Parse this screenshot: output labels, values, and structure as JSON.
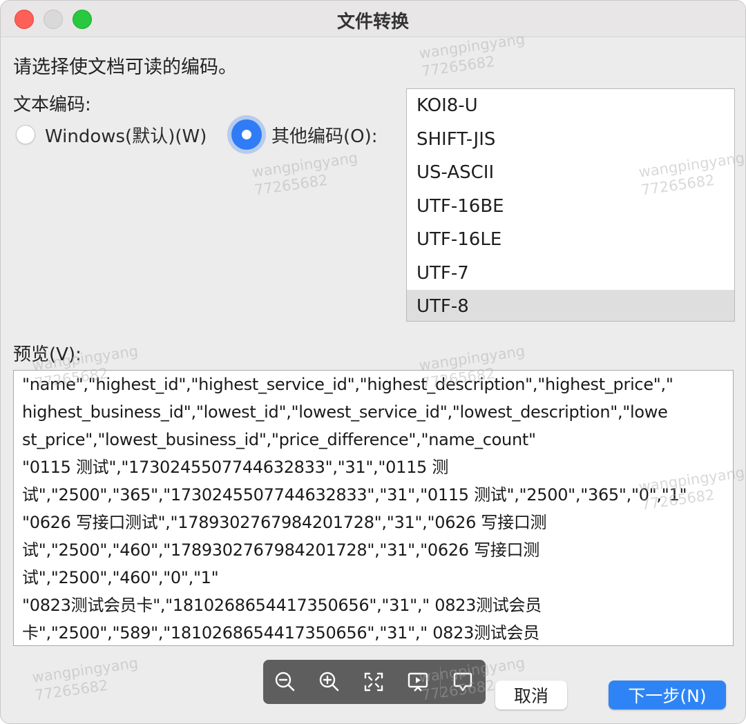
{
  "window": {
    "title": "文件转换"
  },
  "prompt": "请选择使文档可读的编码。",
  "encoding_label": "文本编码:",
  "radio": {
    "windows_label": "Windows(默认)(W)",
    "other_label": "其他编码(O):",
    "selected": "other"
  },
  "encodings": [
    "KOI8-U",
    "SHIFT-JIS",
    "US-ASCII",
    "UTF-16BE",
    "UTF-16LE",
    "UTF-7",
    "UTF-8"
  ],
  "encoding_selected": "UTF-8",
  "preview_label": "预览(V):",
  "preview_lines": [
    "\"name\",\"highest_id\",\"highest_service_id\",\"highest_description\",\"highest_price\",\"",
    "highest_business_id\",\"lowest_id\",\"lowest_service_id\",\"lowest_description\",\"lowe",
    "st_price\",\"lowest_business_id\",\"price_difference\",\"name_count\"",
    "\"0115 测试\",\"1730245507744632833\",\"31\",\"0115 测",
    "试\",\"2500\",\"365\",\"1730245507744632833\",\"31\",\"0115 测试\",\"2500\",\"365\",\"0\",\"1\"",
    "\"0626 写接口测试\",\"1789302767984201728\",\"31\",\"0626 写接口测",
    "试\",\"2500\",\"460\",\"1789302767984201728\",\"31\",\"0626 写接口测",
    "试\",\"2500\",\"460\",\"0\",\"1\"",
    "\"0823测试会员卡\",\"1810268654417350656\",\"31\",\" 0823测试会员",
    "卡\",\"2500\",\"589\",\"1810268654417350656\",\"31\",\" 0823测试会员"
  ],
  "toolbar": {
    "icons": [
      "zoom-out-icon",
      "zoom-in-icon",
      "fullscreen-icon",
      "present-icon",
      "comment-icon"
    ]
  },
  "buttons": {
    "cancel": "取消",
    "next": "下一步(N)"
  },
  "watermark": {
    "name": "wangpingyang",
    "id": "77265682"
  }
}
